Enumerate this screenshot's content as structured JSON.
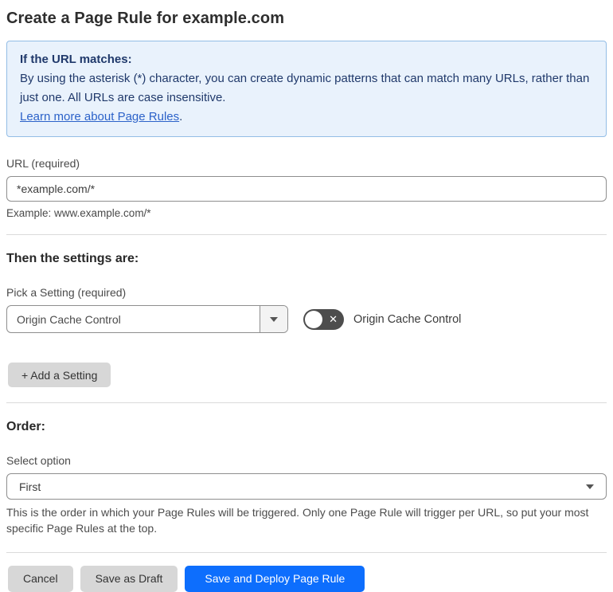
{
  "page": {
    "title": "Create a Page Rule for example.com"
  },
  "info_box": {
    "heading": "If the URL matches:",
    "body": "By using the asterisk (*) character, you can create dynamic patterns that can match many URLs, rather than just one. All URLs are case insensitive.",
    "link": "Learn more about Page Rules",
    "link_suffix": "."
  },
  "url_field": {
    "label": "URL (required)",
    "value": "*example.com/*",
    "example": "Example: www.example.com/*"
  },
  "settings_section": {
    "heading": "Then the settings are:",
    "picker_label": "Pick a Setting (required)",
    "selected_setting": "Origin Cache Control",
    "toggle_state": "off",
    "toggle_icon": "✕",
    "toggle_label": "Origin Cache Control",
    "add_button_label": "+ Add a Setting"
  },
  "order_section": {
    "heading": "Order:",
    "label": "Select option",
    "selected_option": "First",
    "help": "This is the order in which your Page Rules will be triggered. Only one Page Rule will trigger per URL, so put your most specific Page Rules at the top."
  },
  "actions": {
    "cancel": "Cancel",
    "save_draft": "Save as Draft",
    "save_deploy": "Save and Deploy Page Rule"
  },
  "colors": {
    "info_bg": "#e9f2fc",
    "info_border": "#93bde6",
    "info_text": "#20396b",
    "link_blue": "#2c62c9",
    "primary_button": "#0d6efd",
    "gray_button": "#d7d7d7",
    "toggle_off": "#4d4d4d"
  }
}
